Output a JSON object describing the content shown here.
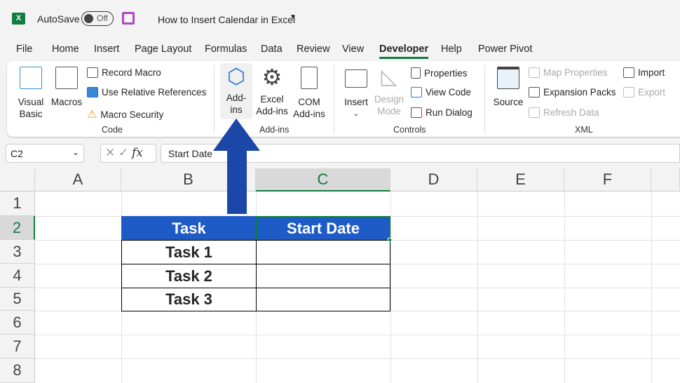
{
  "title_bar": {
    "app_icon": "excel-icon",
    "autosave_label": "AutoSave",
    "autosave_state": "Off",
    "save_icon": "save-icon",
    "document_title": "How to Insert Calendar in Excel"
  },
  "tabs": [
    "File",
    "Home",
    "Insert",
    "Page Layout",
    "Formulas",
    "Data",
    "Review",
    "View",
    "Developer",
    "Help",
    "Power Pivot"
  ],
  "active_tab": "Developer",
  "ribbon": {
    "code": {
      "label": "Code",
      "visual_basic": [
        "Visual",
        "Basic"
      ],
      "macros": "Macros",
      "record_macro": "Record Macro",
      "use_relative": "Use Relative References",
      "macro_security": "Macro Security"
    },
    "addins": {
      "label": "Add-ins",
      "addins": [
        "Add-",
        "ins"
      ],
      "excel_addins": [
        "Excel",
        "Add-ins"
      ],
      "com_addins": [
        "COM",
        "Add-ins"
      ]
    },
    "controls": {
      "label": "Controls",
      "insert": "Insert",
      "design_mode": [
        "Design",
        "Mode"
      ],
      "properties": "Properties",
      "view_code": "View Code",
      "run_dialog": "Run Dialog"
    },
    "xml": {
      "label": "XML",
      "source": "Source",
      "map_properties": "Map Properties",
      "expansion_packs": "Expansion Packs",
      "refresh_data": "Refresh Data",
      "import": "Import",
      "export": "Export"
    }
  },
  "formula_bar": {
    "name_box": "C2",
    "fx": "fx",
    "content": "Start Date"
  },
  "columns": [
    "A",
    "B",
    "C",
    "D",
    "E",
    "F"
  ],
  "rows": [
    "1",
    "2",
    "3",
    "4",
    "5",
    "6",
    "7",
    "8"
  ],
  "table": {
    "headers": [
      "Task",
      "Start Date"
    ],
    "rows": [
      [
        "Task 1",
        ""
      ],
      [
        "Task 2",
        ""
      ],
      [
        "Task 3",
        ""
      ]
    ],
    "header_color": "#1f5bc6"
  },
  "arrow_color": "#1a47a8"
}
